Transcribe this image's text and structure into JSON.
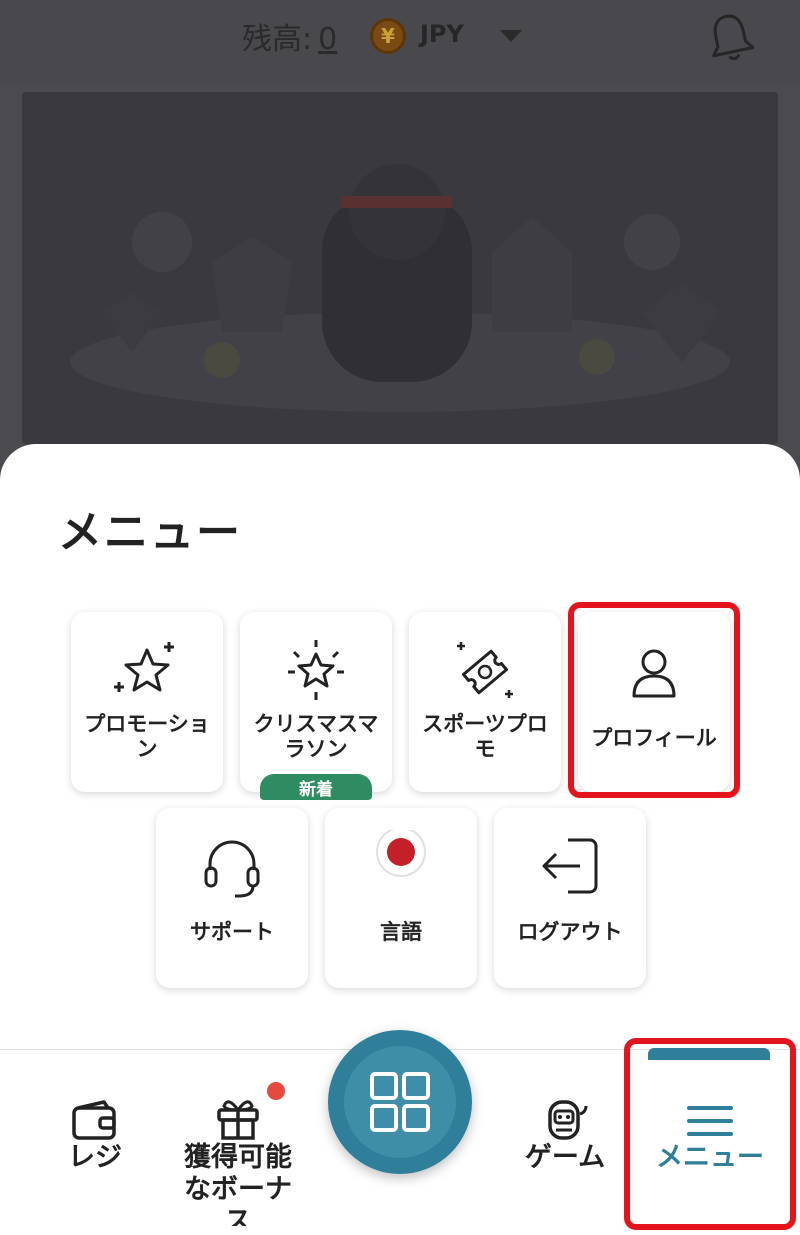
{
  "header": {
    "balance_label": "残高:",
    "balance_value": "0",
    "currency_symbol": "¥",
    "currency": "JPY"
  },
  "sheet": {
    "title": "メニュー",
    "items": [
      {
        "label": "プロモーション",
        "icon": "star-sparkle-icon"
      },
      {
        "label": "クリスマスマラソン",
        "icon": "star-burst-icon",
        "badge": "新着"
      },
      {
        "label": "スポーツプロモ",
        "icon": "ticket-sparkle-icon"
      },
      {
        "label": "プロフィール",
        "icon": "user-icon",
        "highlighted": true
      },
      {
        "label": "サポート",
        "icon": "headset-icon"
      },
      {
        "label": "言語",
        "icon": "japan-flag-icon"
      },
      {
        "label": "ログアウト",
        "icon": "logout-icon"
      }
    ]
  },
  "nav": {
    "items": [
      {
        "label": "レジ",
        "icon": "wallet-icon"
      },
      {
        "label": "獲得可能なボーナス",
        "icon": "gift-icon",
        "dot": true
      },
      {
        "label": "",
        "icon": "grid-icon"
      },
      {
        "label": "ゲーム",
        "icon": "robot-icon"
      },
      {
        "label": "メニュー",
        "icon": "menu-icon",
        "active": true,
        "highlighted": true
      }
    ]
  },
  "colors": {
    "accent": "#2f7f9b",
    "highlight": "#e4141c",
    "badge": "#2e8b62",
    "notification_dot": "#e64a3e",
    "overlay": "#4a4a4f"
  }
}
